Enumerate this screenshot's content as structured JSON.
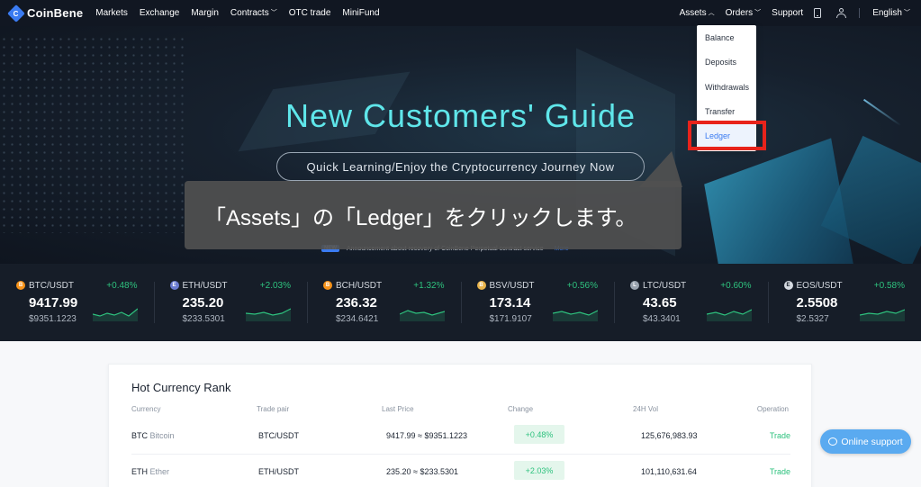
{
  "brand": {
    "name": "CoinBene",
    "mark": "C"
  },
  "nav": {
    "left": [
      "Markets",
      "Exchange",
      "Margin",
      "Contracts",
      "OTC trade",
      "MiniFund"
    ],
    "assets": "Assets",
    "orders": "Orders",
    "support": "Support",
    "language": "English"
  },
  "dropdown": {
    "balance": "Balance",
    "deposits": "Deposits",
    "withdrawals": "Withdrawals",
    "transfer": "Transfer",
    "ledger": "Ledger"
  },
  "hero": {
    "title": "New Customers' Guide",
    "button": "Quick Learning/Enjoy the Cryptocurrency Journey Now",
    "announce_badge": "NEW",
    "announcement": "Announcement about recovery of CoinBene Perpetual contract service",
    "more": "More"
  },
  "callout": "「Assets」の「Ledger」をクリックします。",
  "ticker": [
    {
      "coin": "B",
      "pair": "BTC/USDT",
      "change": "+0.48%",
      "price": "9417.99",
      "fiat": "$9351.1223",
      "color": "#f7931a"
    },
    {
      "coin": "E",
      "pair": "ETH/USDT",
      "change": "+2.03%",
      "price": "235.20",
      "fiat": "$233.5301",
      "color": "#6a7bd1"
    },
    {
      "coin": "B",
      "pair": "BCH/USDT",
      "change": "+1.32%",
      "price": "236.32",
      "fiat": "$234.6421",
      "color": "#f7931a"
    },
    {
      "coin": "B",
      "pair": "BSV/USDT",
      "change": "+0.56%",
      "price": "173.14",
      "fiat": "$171.9107",
      "color": "#e9b44c"
    },
    {
      "coin": "L",
      "pair": "LTC/USDT",
      "change": "+0.60%",
      "price": "43.65",
      "fiat": "$43.3401",
      "color": "#9aa4b0"
    },
    {
      "coin": "E",
      "pair": "EOS/USDT",
      "change": "+0.58%",
      "price": "2.5508",
      "fiat": "$2.5327",
      "color": "#d5dae1"
    }
  ],
  "rank": {
    "title": "Hot Currency Rank",
    "headers": {
      "currency": "Currency",
      "pair": "Trade pair",
      "last": "Last Price",
      "change": "Change",
      "vol": "24H Vol",
      "op": "Operation"
    },
    "rows": [
      {
        "sym": "BTC",
        "name": "Bitcoin",
        "pair": "BTC/USDT",
        "last": "9417.99 ≈ $9351.1223",
        "change": "+0.48%",
        "vol": "125,676,983.93",
        "op": "Trade"
      },
      {
        "sym": "ETH",
        "name": "Ether",
        "pair": "ETH/USDT",
        "last": "235.20 ≈ $233.5301",
        "change": "+2.03%",
        "vol": "101,110,631.64",
        "op": "Trade"
      }
    ]
  },
  "support": "Online support"
}
